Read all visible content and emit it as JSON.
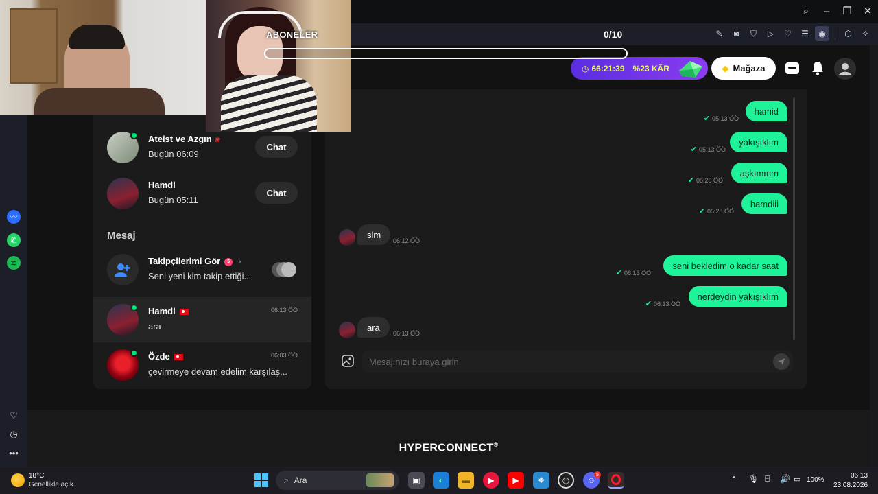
{
  "browser": {
    "counter": "0/10"
  },
  "header": {
    "timer": "66:21:39",
    "profit": "%23 KÂR",
    "shop_label": "Mağaza"
  },
  "overlay": {
    "subscribers_label": "ABONELER"
  },
  "left_panel": {
    "contacts": [
      {
        "name": "Ateist ve Azgın",
        "time": "Bugün 06:09",
        "button": "Chat"
      },
      {
        "name": "Hamdi",
        "time": "Bugün 05:11",
        "button": "Chat"
      }
    ],
    "section_title": "Mesaj",
    "followers": {
      "title": "Takipçilerimi Gör",
      "badge": "5",
      "subtitle": "Seni yeni kim takip ettiği..."
    },
    "conversations": [
      {
        "name": "Hamdi",
        "last": "ara",
        "time": "06:13 ÖÖ"
      },
      {
        "name": "Özde",
        "last": "çevirmeye devam edelim karşılaş...",
        "time": "06:03 ÖÖ"
      }
    ]
  },
  "chat": {
    "messages": [
      {
        "text": "hamid",
        "time": "05:13 ÖÖ"
      },
      {
        "text": "yakışıklım",
        "time": "05:13 ÖÖ"
      },
      {
        "text": "aşkımmm",
        "time": "05:28 ÖÖ"
      },
      {
        "text": "hamdiii",
        "time": "05:28 ÖÖ"
      },
      {
        "text": "slm",
        "time": "06:12 ÖÖ"
      },
      {
        "text": "seni bekledim o kadar saat",
        "time": "06:13 ÖÖ"
      },
      {
        "text": "nerdeydin yakışıklım",
        "time": "06:13 ÖÖ"
      },
      {
        "text": "ara",
        "time": "06:13 ÖÖ"
      }
    ],
    "input_placeholder": "Mesajınızı buraya girin"
  },
  "footer": {
    "brand": "HYPERCONNECT",
    "mark": "®"
  },
  "taskbar": {
    "temperature": "18°C",
    "weather": "Genellikle açık",
    "search_label": "Ara",
    "discord_badge": "5",
    "battery": "100%",
    "clock_time": "06:13",
    "clock_date": "23.08.2026"
  },
  "colors": {
    "accent_green": "#1ff39a",
    "panel": "#1b1b1b",
    "purple": "#7a35ee"
  }
}
